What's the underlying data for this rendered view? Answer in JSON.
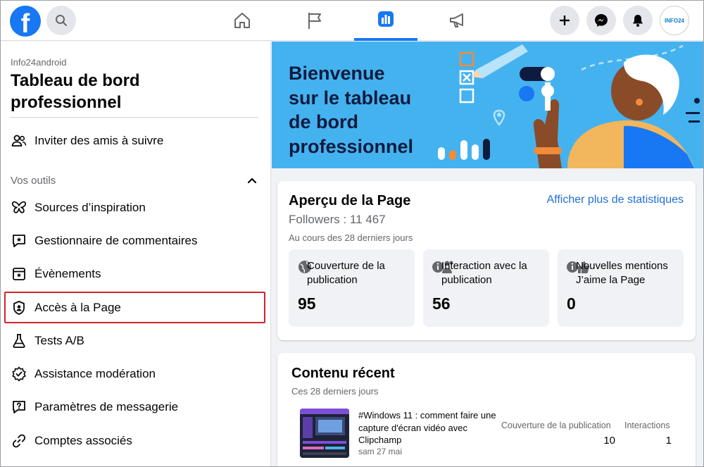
{
  "topbar": {
    "logo_letter": "f",
    "avatar_text": "INFO24"
  },
  "sidebar": {
    "page_name": "Info24android",
    "title": "Tableau de bord professionnel",
    "invite_label": "Inviter des amis à suivre",
    "tools_section": "Vos outils",
    "items": [
      {
        "label": "Sources d’inspiration",
        "icon": "butterfly-icon"
      },
      {
        "label": "Gestionnaire de commentaires",
        "icon": "comment-star-icon"
      },
      {
        "label": "Évènements",
        "icon": "calendar-star-icon"
      },
      {
        "label": "Accès à la Page",
        "icon": "shield-user-icon"
      },
      {
        "label": "Tests A/B",
        "icon": "flask-icon"
      },
      {
        "label": "Assistance modération",
        "icon": "gear-check-icon"
      },
      {
        "label": "Paramètres de messagerie",
        "icon": "chat-question-icon"
      },
      {
        "label": "Comptes associés",
        "icon": "link-icon"
      }
    ]
  },
  "banner": {
    "text": "Bienvenue sur le tableau de bord professionnel"
  },
  "overview": {
    "title": "Aperçu de la Page",
    "link": "Afficher plus de statistiques",
    "followers": "Followers : 11 467",
    "period": "Au cours des 28 derniers jours",
    "stats": [
      {
        "label": "Couverture de la publication",
        "value": "95"
      },
      {
        "label": "Interaction avec la publication",
        "value": "56"
      },
      {
        "label": "Nouvelles mentions J’aime la Page",
        "value": "0"
      }
    ]
  },
  "recent": {
    "title": "Contenu récent",
    "period": "Ces 28 derniers jours",
    "col_reach": "Couverture de la publication",
    "col_interactions": "Interactions",
    "post": {
      "title": "#Windows 11 : comment faire une capture d'écran vidéo avec Clipchamp",
      "date": "sam 27 mai",
      "reach": "10",
      "interactions": "1"
    }
  },
  "colors": {
    "brand": "#1877f2",
    "banner": "#45b2f0",
    "highlight": "#d0242b",
    "link": "#216fdb"
  }
}
